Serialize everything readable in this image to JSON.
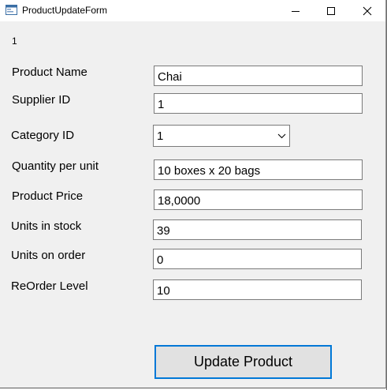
{
  "window": {
    "title": "ProductUpdateForm",
    "icons": {
      "app": "form-app-icon",
      "minimize": "minimize-icon",
      "maximize": "maximize-icon",
      "close": "close-icon"
    }
  },
  "form": {
    "id_label": "1",
    "fields": {
      "product_name": {
        "label": "Product Name",
        "value": "Chai"
      },
      "supplier_id": {
        "label": "Supplier ID",
        "value": "1"
      },
      "category_id": {
        "label": "Category ID",
        "value": "1"
      },
      "quantity_per_unit": {
        "label": "Quantity per unit",
        "value": "10 boxes x 20 bags"
      },
      "product_price": {
        "label": "Product Price",
        "value": "18,0000"
      },
      "units_in_stock": {
        "label": "Units in stock",
        "value": "39"
      },
      "units_on_order": {
        "label": "Units on order",
        "value": "0"
      },
      "reorder_level": {
        "label": "ReOrder Level",
        "value": "10"
      }
    },
    "update_button_label": "Update Product"
  },
  "colors": {
    "window_bg": "#f0f0f0",
    "titlebar_bg": "#ffffff",
    "button_bg": "#e1e1e1",
    "button_focus_border": "#0078d7",
    "textbox_border": "#7a7a7a"
  }
}
